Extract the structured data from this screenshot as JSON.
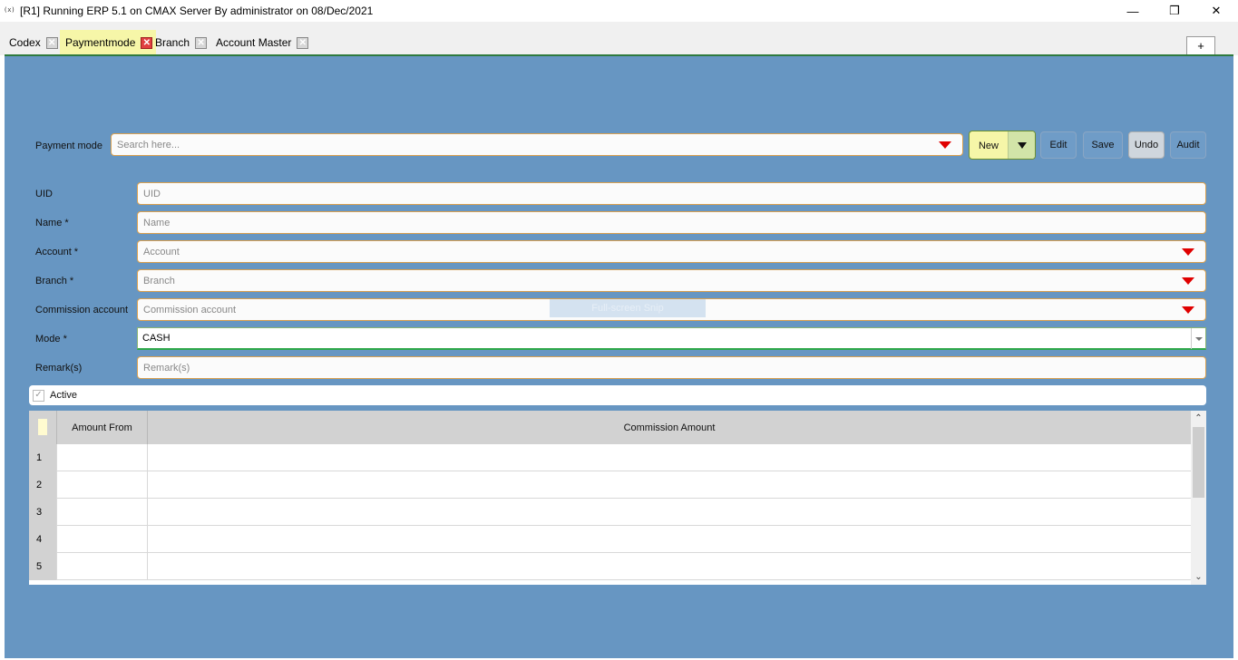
{
  "window": {
    "app_icon": "(x)",
    "title": "[R1] Running ERP 5.1 on CMAX Server By administrator on 08/Dec/2021",
    "minimize_glyph": "—",
    "maximize_glyph": "❐",
    "close_glyph": "✕"
  },
  "tabs": [
    {
      "label": "Codex",
      "active": false
    },
    {
      "label": "Paymentmode",
      "active": true
    },
    {
      "label": "Branch",
      "active": false
    },
    {
      "label": "Account Master",
      "active": false
    }
  ],
  "tab_close_glyph": "✕",
  "tab_add_label": "+",
  "toolbar": {
    "payment_mode_label": "Payment mode",
    "search_placeholder": "Search here...",
    "new_label": "New",
    "edit_label": "Edit",
    "save_label": "Save",
    "undo_label": "Undo",
    "audit_label": "Audit"
  },
  "form": {
    "uid": {
      "label": "UID",
      "placeholder": "UID"
    },
    "name": {
      "label": "Name *",
      "placeholder": "Name"
    },
    "account": {
      "label": "Account *",
      "placeholder": "Account"
    },
    "branch": {
      "label": "Branch *",
      "placeholder": "Branch"
    },
    "commission_account": {
      "label": "Commission account",
      "placeholder": "Commission account"
    },
    "mode": {
      "label": "Mode *",
      "value": "CASH"
    },
    "remarks": {
      "label": "Remark(s)",
      "placeholder": "Remark(s)"
    },
    "active": {
      "label": "Active",
      "checked": true,
      "check_glyph": "✓"
    }
  },
  "grid": {
    "columns": [
      "Amount From",
      "Commission Amount"
    ],
    "rows": [
      "1",
      "2",
      "3",
      "4",
      "5"
    ]
  },
  "overlay_text": "Full-screen Snip",
  "colors": {
    "panel": "#6796c2",
    "active_tab": "#f6f6a8",
    "field_border": "#d9a050",
    "dropdown_caret": "#e00000"
  }
}
